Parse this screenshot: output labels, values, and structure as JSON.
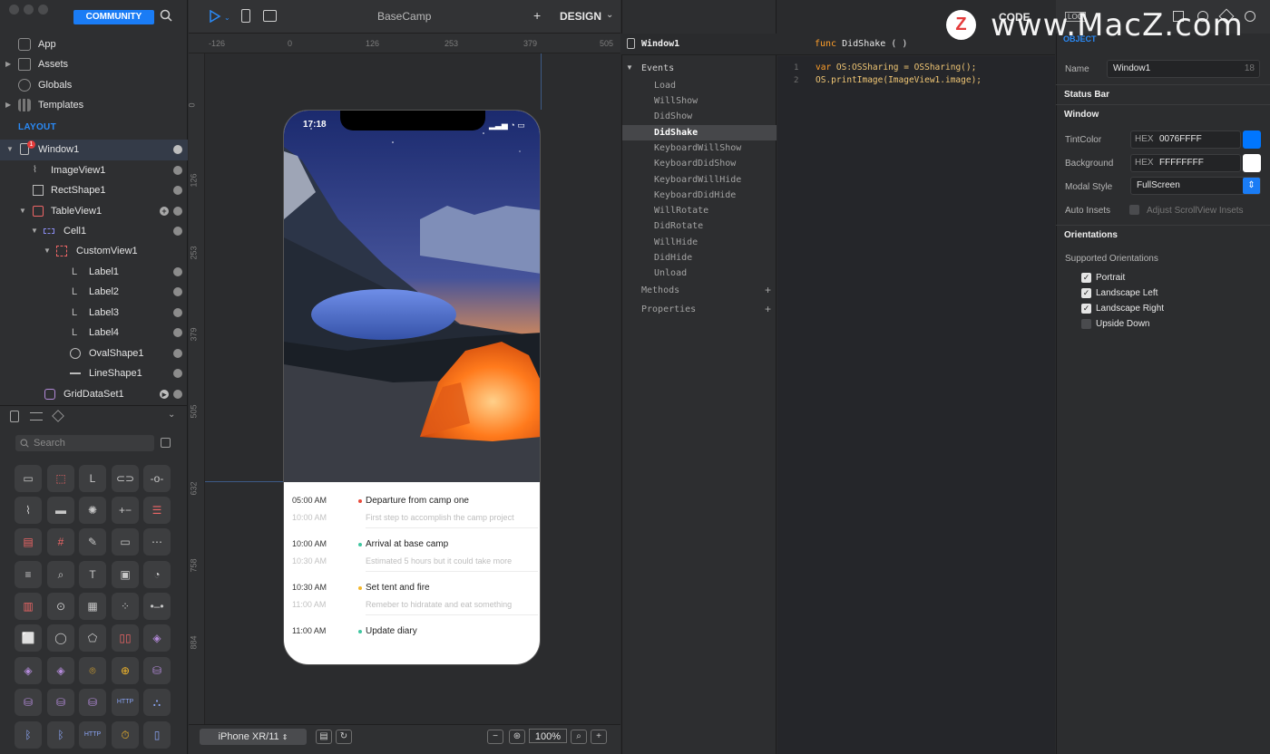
{
  "sidebar": {
    "community_label": "COMMUNITY",
    "nav": [
      {
        "label": "App"
      },
      {
        "label": "Assets"
      },
      {
        "label": "Globals"
      },
      {
        "label": "Templates"
      }
    ],
    "layout_label": "LAYOUT",
    "tree": [
      {
        "label": "Window1",
        "badge": "1"
      },
      {
        "label": "ImageView1"
      },
      {
        "label": "RectShape1"
      },
      {
        "label": "TableView1"
      },
      {
        "label": "Cell1"
      },
      {
        "label": "CustomView1"
      },
      {
        "label": "Label1"
      },
      {
        "label": "Label2"
      },
      {
        "label": "Label3"
      },
      {
        "label": "Label4"
      },
      {
        "label": "OvalShape1"
      },
      {
        "label": "LineShape1"
      },
      {
        "label": "GridDataSet1"
      }
    ],
    "search_placeholder": "Search"
  },
  "canvas": {
    "title": "BaseCamp",
    "plus": "+",
    "design_label": "DESIGN",
    "ruler_top": [
      "-126",
      "0",
      "126",
      "253",
      "379",
      "505"
    ],
    "ruler_left": [
      "0",
      "126",
      "253",
      "379",
      "505",
      "632",
      "758",
      "884"
    ],
    "device_label": "iPhone XR/11",
    "zoom": "100%",
    "phone": {
      "clock": "17:18",
      "timeline": [
        {
          "time": "05:00 AM",
          "title": "Departure from camp one",
          "sub_time": "10:00 AM",
          "sub": "First step to accomplish the camp project",
          "dot": "#e84b3c"
        },
        {
          "time": "10:00 AM",
          "title": "Arrival at base camp",
          "sub_time": "10:30 AM",
          "sub": "Estimated 5 hours but it could take more",
          "dot": "#3fc6a0"
        },
        {
          "time": "10:30 AM",
          "title": "Set tent and fire",
          "sub_time": "11:00 AM",
          "sub": "Remeber to hidratate and eat something",
          "dot": "#f4b72a"
        },
        {
          "time": "11:00 AM",
          "title": "Update diary",
          "dot": "#3fc6a0"
        }
      ]
    }
  },
  "events": {
    "window_label": "Window1",
    "events_label": "Events",
    "items": [
      "Load",
      "WillShow",
      "DidShow",
      "DidShake",
      "KeyboardWillShow",
      "KeyboardDidShow",
      "KeyboardWillHide",
      "KeyboardDidHide",
      "WillRotate",
      "DidRotate",
      "WillHide",
      "DidHide",
      "Unload"
    ],
    "selected": "DidShake",
    "methods_label": "Methods",
    "properties_label": "Properties"
  },
  "code": {
    "func_kw": "func",
    "func_name": "DidShake  (  )",
    "lines": [
      {
        "n": "1",
        "kw": "var",
        "text": " OS:OSSharing = OSSharing();"
      },
      {
        "n": "2",
        "kw": "",
        "text": "OS.printImage(ImageView1.image);"
      }
    ]
  },
  "inspector": {
    "code_label": "CODE",
    "log_label": "LOG",
    "object_label": "OBJECT",
    "name_label": "Name",
    "name_value": "Window1",
    "name_count": "18",
    "status_bar": "Status Bar",
    "window": "Window",
    "tint_label": "TintColor",
    "hex_tag": "HEX",
    "tint_value": "0076FFFF",
    "tint_color": "#0076FF",
    "bg_label": "Background",
    "bg_value": "FFFFFFFF",
    "modal_label": "Modal Style",
    "modal_value": "FullScreen",
    "insets_label": "Auto Insets",
    "insets_value": "Adjust ScrollView Insets",
    "orientations": "Orientations",
    "supported": "Supported Orientations",
    "options": [
      {
        "label": "Portrait",
        "checked": true
      },
      {
        "label": "Landscape Left",
        "checked": true
      },
      {
        "label": "Landscape Right",
        "checked": true
      },
      {
        "label": "Upside Down",
        "checked": false
      }
    ]
  },
  "watermark": {
    "logo": "Z",
    "text": "www.MacZ.com"
  }
}
